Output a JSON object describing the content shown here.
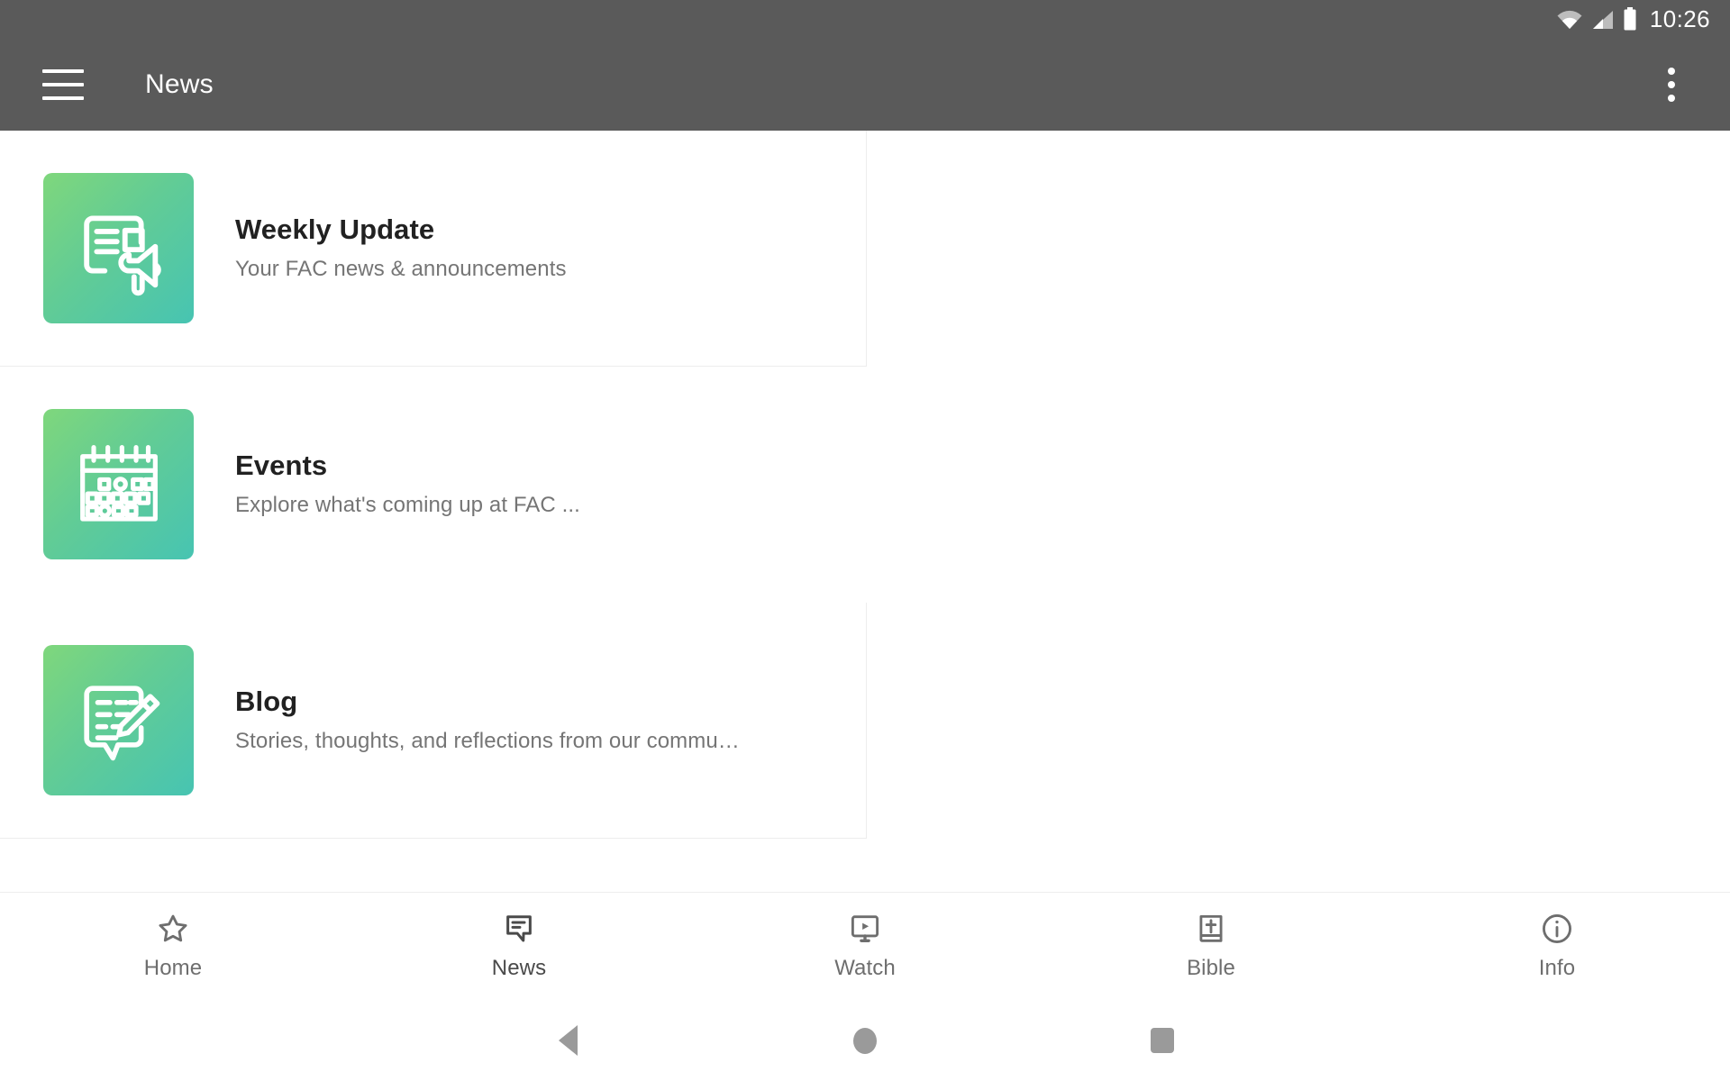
{
  "status_bar": {
    "time": "10:26",
    "icons": [
      "wifi-icon",
      "cellular-signal-icon",
      "battery-icon"
    ]
  },
  "app_bar": {
    "menu_icon": "hamburger-menu-icon",
    "title": "News",
    "overflow_icon": "overflow-menu-icon"
  },
  "content": {
    "items": [
      {
        "title": "Weekly Update",
        "subtitle": "Your FAC news & announcements",
        "icon": "newspaper-megaphone-icon"
      },
      {
        "title": "Events",
        "subtitle": "Explore what's coming up at FAC ...",
        "icon": "calendar-icon"
      },
      {
        "title": "Blog",
        "subtitle": "Stories, thoughts, and reflections from our commu…",
        "icon": "note-pencil-icon"
      }
    ]
  },
  "bottom_nav": {
    "items": [
      {
        "label": "Home",
        "icon": "star-outline-icon",
        "selected": false
      },
      {
        "label": "News",
        "icon": "speech-bubble-icon",
        "selected": true
      },
      {
        "label": "Watch",
        "icon": "monitor-play-icon",
        "selected": false
      },
      {
        "label": "Bible",
        "icon": "book-cross-icon",
        "selected": false
      },
      {
        "label": "Info",
        "icon": "info-circle-icon",
        "selected": false
      }
    ]
  },
  "system_nav": {
    "back": "back-triangle-icon",
    "home": "home-circle-icon",
    "recents": "recents-square-icon"
  },
  "colors": {
    "app_bar": "#5a5a5a",
    "tile_gradient_start": "#7fd77c",
    "tile_gradient_end": "#47c4b2",
    "title_text": "#212121",
    "subtitle_text": "#757575",
    "divider": "#ededed"
  }
}
